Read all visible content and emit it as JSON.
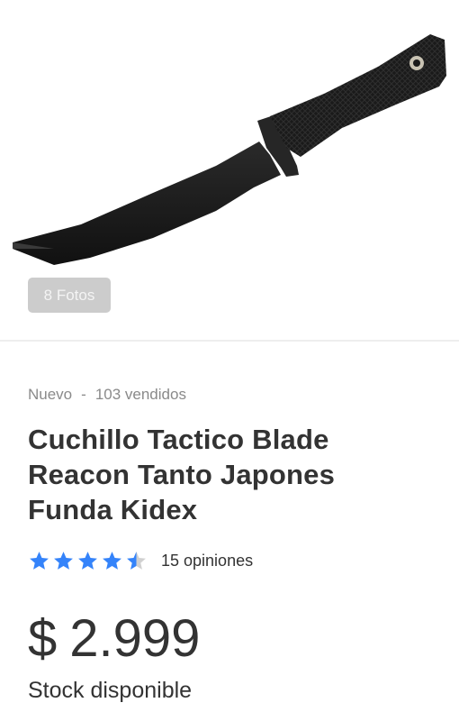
{
  "gallery": {
    "photos_label": "8 Fotos",
    "image_icon": "knife-product-image"
  },
  "product": {
    "condition": "Nuevo",
    "separator": "-",
    "sold": "103 vendidos",
    "title": "Cuchillo Tactico Blade Reacon Tanto Japones Funda Kidex",
    "rating": 4.5,
    "rating_max": 5,
    "reviews": "15 opiniones",
    "currency": "$",
    "price": "2.999",
    "stock": "Stock disponible"
  },
  "colors": {
    "star": "#3483fa",
    "star_empty": "#d0d0d0",
    "text": "#333333",
    "muted": "#8a8a8a"
  }
}
